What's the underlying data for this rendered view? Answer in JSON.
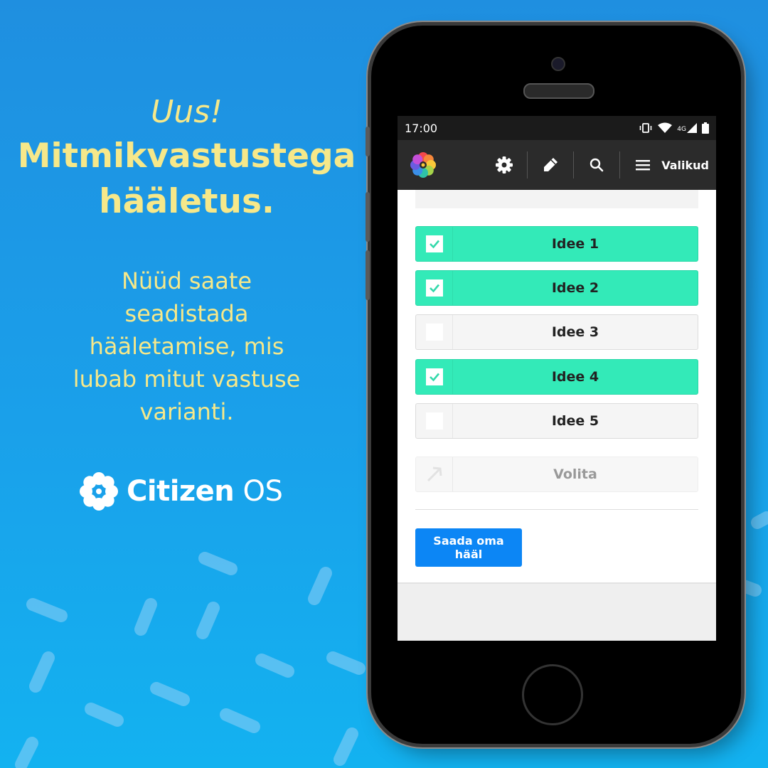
{
  "promo": {
    "kicker": "Uus!",
    "headline_line1": "Mitmikvastustega",
    "headline_line2": "hääletus.",
    "description": "Nüüd saate seadistada hääletamise, mis lubab mitut vastuse varianti."
  },
  "brand": {
    "name_bold": "Citizen",
    "name_light": " OS"
  },
  "statusbar": {
    "time": "17:00",
    "network": "4G"
  },
  "appbar": {
    "menu_label": "Valikud"
  },
  "options": [
    {
      "label": "Idee 1",
      "checked": true
    },
    {
      "label": "Idee 2",
      "checked": true
    },
    {
      "label": "Idee 3",
      "checked": false
    },
    {
      "label": "Idee 4",
      "checked": true
    },
    {
      "label": "Idee 5",
      "checked": false
    }
  ],
  "delegate": {
    "label": "Volita"
  },
  "submit": {
    "label": "Saada oma hääl"
  },
  "colors": {
    "background": "#1aa0ea",
    "promo_text": "#f6e88a",
    "checked": "#33eab8",
    "submit": "#0c86f5"
  }
}
